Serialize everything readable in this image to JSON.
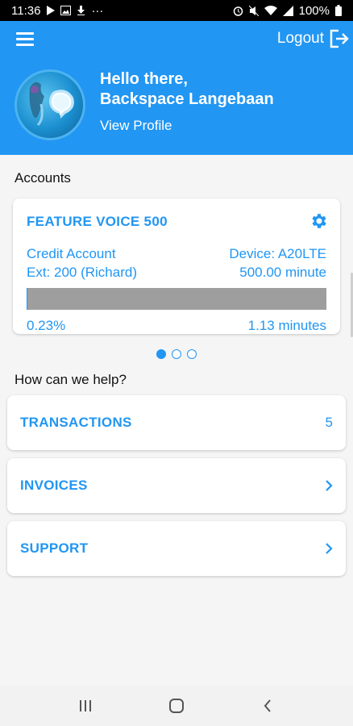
{
  "status_bar": {
    "time": "11:36",
    "more": "···",
    "battery": "100%"
  },
  "header": {
    "logout_label": "Logout",
    "greeting_line1": "Hello there,",
    "greeting_line2": "Backspace Langebaan",
    "view_profile": "View Profile"
  },
  "accounts": {
    "section_title": "Accounts",
    "card": {
      "title": "FEATURE VOICE 500",
      "account_type": "Credit Account",
      "device": "Device: A20LTE",
      "extension": "Ext: 200 (Richard)",
      "allowance": "500.00 minute",
      "usage_percent_label": "0.23%",
      "usage_fraction": 0.0023,
      "used": "1.13 minutes"
    },
    "pager": {
      "count": 3,
      "active_index": 0
    }
  },
  "help": {
    "section_title": "How can we help?",
    "items": [
      {
        "label": "TRANSACTIONS",
        "trail": "5"
      },
      {
        "label": "INVOICES",
        "trail": "›"
      },
      {
        "label": "SUPPORT",
        "trail": "›"
      }
    ]
  },
  "colors": {
    "primary": "#2196f3",
    "status_bar": "#000000",
    "progress_track": "#9e9e9e",
    "background": "#f5f5f5"
  },
  "icons": [
    "play-icon",
    "image-icon",
    "download-icon",
    "alarm-icon",
    "mute-icon",
    "wifi-icon",
    "signal-icon",
    "battery-icon",
    "menu-icon",
    "logout-icon",
    "settings-gear-icon",
    "chevron-right-icon",
    "recents-icon",
    "home-icon",
    "back-icon"
  ]
}
